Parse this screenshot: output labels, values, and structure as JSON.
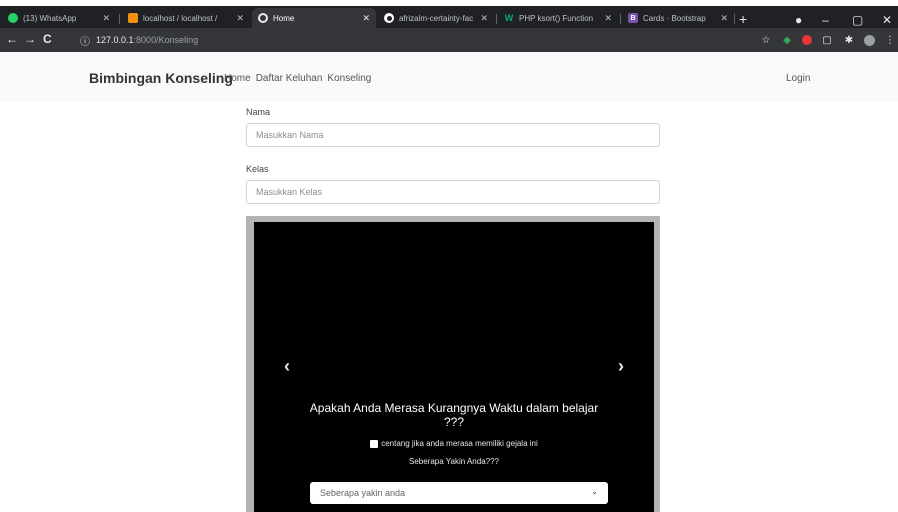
{
  "browser": {
    "tabs": [
      {
        "title": "(13) WhatsApp",
        "icon": "whatsapp-icon",
        "color": "#25d366",
        "glyph": ""
      },
      {
        "title": "localhost / localhost /",
        "icon": "phpmyadmin-icon",
        "color": "#f29111",
        "glyph": ""
      },
      {
        "title": "Home",
        "icon": "globe-icon",
        "color": "#e8eaed",
        "glyph": "",
        "active": true
      },
      {
        "title": "afrizalm-certainty-fac",
        "icon": "github-icon",
        "color": "#ffffff",
        "glyph": ""
      },
      {
        "title": "PHP ksort() Function",
        "icon": "w3schools-icon",
        "color": "#04aa6d",
        "glyph": "W"
      },
      {
        "title": "Cards · Bootstrap",
        "icon": "bootstrap-icon",
        "color": "#7952b3",
        "glyph": "B"
      }
    ],
    "new_tab": "+",
    "window_controls": {
      "minimize": "–",
      "maximize": "▢",
      "close": "✕"
    },
    "url_host": "127.0.0.1",
    "url_path": ":8000/Konseling"
  },
  "navbar": {
    "brand": "Bimbingan Konseling",
    "links": [
      "Home",
      "Daftar Keluhan",
      "Konseling"
    ],
    "login": "Login"
  },
  "form": {
    "nama_label": "Nama",
    "nama_placeholder": "Masukkan Nama",
    "kelas_label": "Kelas",
    "kelas_placeholder": "Masukkan Kelas"
  },
  "carousel": {
    "question": "Apakah Anda Merasa Kurangnya Waktu dalam belajar ???",
    "checkbox_label": "centang jika anda merasa memiliki gejala ini",
    "confidence_prompt": "Seberapa Yakin Anda???",
    "select_value": "Seberapa yakin anda",
    "prev": "‹",
    "next": "›"
  }
}
